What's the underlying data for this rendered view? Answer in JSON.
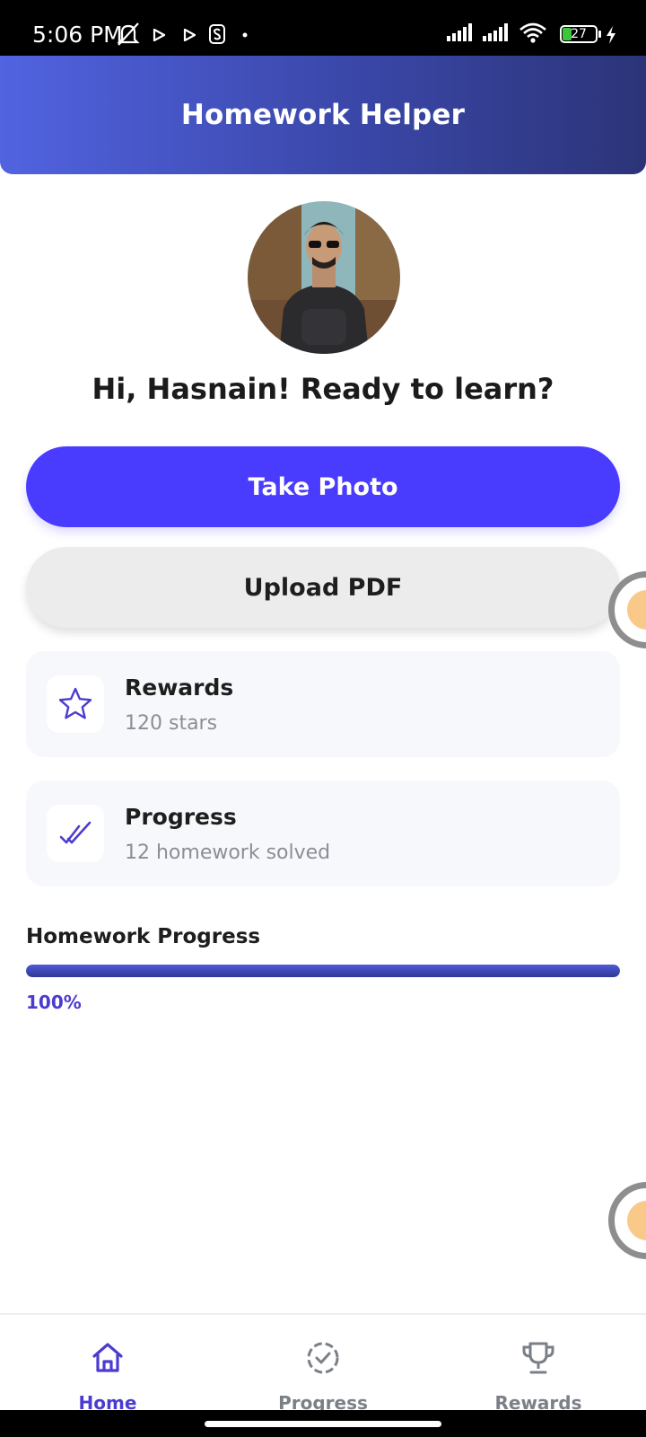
{
  "status_bar": {
    "time": "5:06 PM",
    "battery": "27",
    "icons": [
      "bell-off-icon",
      "play-icon",
      "play-icon",
      "s-icon",
      "dot-icon",
      "signal-icon",
      "signal-icon",
      "wifi-icon",
      "battery-icon",
      "charging-icon"
    ]
  },
  "header": {
    "title": "Homework Helper"
  },
  "profile": {
    "greeting": "Hi, Hasnain! Ready to learn?"
  },
  "actions": {
    "take_photo": "Take Photo",
    "upload_pdf": "Upload PDF"
  },
  "cards": [
    {
      "title": "Rewards",
      "subtitle": "120 stars",
      "icon": "star-icon"
    },
    {
      "title": "Progress",
      "subtitle": "12 homework solved",
      "icon": "double-check-icon"
    }
  ],
  "homework_progress": {
    "label": "Homework Progress",
    "percent_text": "100%",
    "value": 100
  },
  "bottom_nav": [
    {
      "label": "Home",
      "icon": "home-icon",
      "active": true
    },
    {
      "label": "Progress",
      "icon": "progress-icon",
      "active": false
    },
    {
      "label": "Rewards",
      "icon": "trophy-icon",
      "active": false
    }
  ],
  "colors": {
    "primary": "#4a3cff",
    "header_start": "#5163e0",
    "header_end": "#2c3478",
    "active_nav": "#4a3cd0",
    "inactive_nav": "#7b7f88"
  }
}
